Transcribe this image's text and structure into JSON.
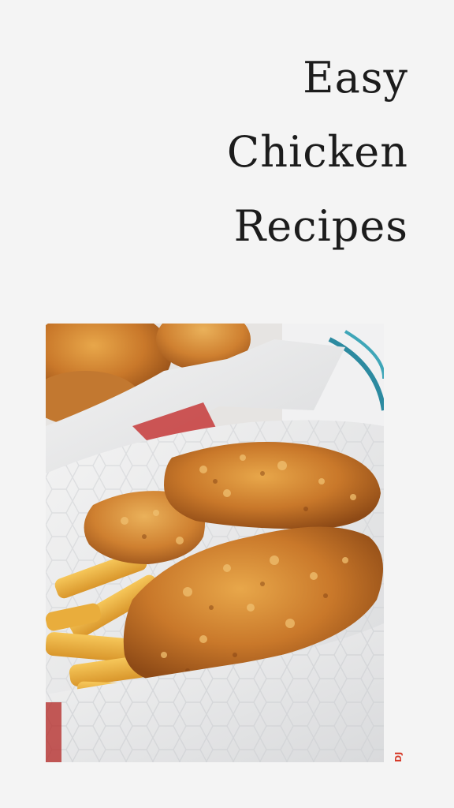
{
  "title": {
    "line1": "Easy",
    "line2": "Chicken",
    "line3": "Recipes"
  },
  "photo": {
    "subject": "fried-chicken-tenders-with-fries"
  },
  "watermark": {
    "text": "DJ"
  },
  "colors": {
    "background": "#f4f4f4",
    "title": "#1c1c1c",
    "watermark": "#d63b2a"
  }
}
